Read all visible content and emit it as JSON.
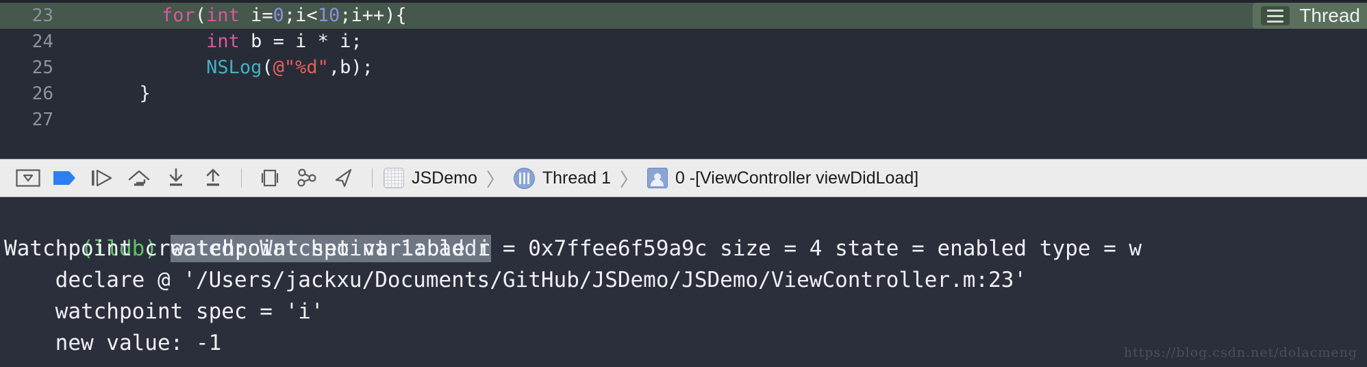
{
  "editor": {
    "current_line_number": "23",
    "lines": [
      {
        "number": "23",
        "current": true,
        "tokens": [
          {
            "t": "        ",
            "c": "plain"
          },
          {
            "t": "for",
            "c": "kw"
          },
          {
            "t": "(",
            "c": "plain"
          },
          {
            "t": "int",
            "c": "kw"
          },
          {
            "t": " i=",
            "c": "plain"
          },
          {
            "t": "0",
            "c": "num"
          },
          {
            "t": ";i<",
            "c": "plain"
          },
          {
            "t": "10",
            "c": "num"
          },
          {
            "t": ";i++){",
            "c": "plain"
          }
        ]
      },
      {
        "number": "24",
        "current": false,
        "tokens": [
          {
            "t": "            ",
            "c": "plain"
          },
          {
            "t": "int",
            "c": "kw"
          },
          {
            "t": " b = i * i;",
            "c": "plain"
          }
        ]
      },
      {
        "number": "25",
        "current": false,
        "tokens": [
          {
            "t": "            ",
            "c": "plain"
          },
          {
            "t": "NSLog",
            "c": "fn"
          },
          {
            "t": "(",
            "c": "plain"
          },
          {
            "t": "@\"%d\"",
            "c": "str"
          },
          {
            "t": ",b);",
            "c": "plain"
          }
        ]
      },
      {
        "number": "26",
        "current": false,
        "tokens": [
          {
            "t": "      }",
            "c": "plain"
          }
        ]
      },
      {
        "number": "27",
        "current": false,
        "tokens": [
          {
            "t": "",
            "c": "plain"
          }
        ]
      }
    ],
    "thread_badge": {
      "label": "Thread",
      "icon": "hamburger-icon"
    }
  },
  "debug_toolbar": {
    "buttons": [
      {
        "name": "hide-debug-area-button",
        "icon": "panel-collapse-icon"
      },
      {
        "name": "deactivate-breakpoints-button",
        "icon": "breakpoint-arrow-icon"
      },
      {
        "name": "continue-button",
        "icon": "continue-program-icon"
      },
      {
        "name": "step-over-button",
        "icon": "step-over-icon"
      },
      {
        "name": "step-into-button",
        "icon": "step-into-icon"
      },
      {
        "name": "step-out-button",
        "icon": "step-out-icon"
      },
      {
        "name": "debug-view-hierarchy-button",
        "icon": "view-hierarchy-icon"
      },
      {
        "name": "debug-memory-graph-button",
        "icon": "memory-graph-icon"
      },
      {
        "name": "simulate-location-button",
        "icon": "location-arrow-icon"
      }
    ],
    "breadcrumb": [
      {
        "name": "breadcrumb-process",
        "label": "JSDemo",
        "icon": "project-icon"
      },
      {
        "name": "breadcrumb-thread",
        "label": "Thread 1",
        "icon": "thread-icon"
      },
      {
        "name": "breadcrumb-frame",
        "label": "0 -[ViewController viewDidLoad]",
        "icon": "stack-frame-icon"
      }
    ],
    "separator_glyph": "〉"
  },
  "console": {
    "prompt": "(lldb) ",
    "command": "watchpoint set variable i",
    "output_lines": [
      "Watchpoint created: Watchpoint 1: addr = 0x7ffee6f59a9c size = 4 state = enabled type = w",
      "    declare @ '/Users/jackxu/Documents/GitHub/JSDemo/JSDemo/ViewController.m:23'",
      "    watchpoint spec = 'i'",
      "    new value: -1"
    ]
  },
  "watermark": {
    "text": "https://blog.csdn.net/dolacmeng"
  },
  "colors": {
    "editor_bg": "#282c36",
    "console_bg": "#2b2f3b",
    "current_line_bg": "#46574b",
    "toolbar_bg": "#ececec",
    "keyword": "#d45ba0",
    "number": "#8b8ee0",
    "function": "#43b0c4",
    "string": "#e2625c",
    "lldb_green": "#62c46a",
    "accent_blue": "#2d7ff0"
  }
}
